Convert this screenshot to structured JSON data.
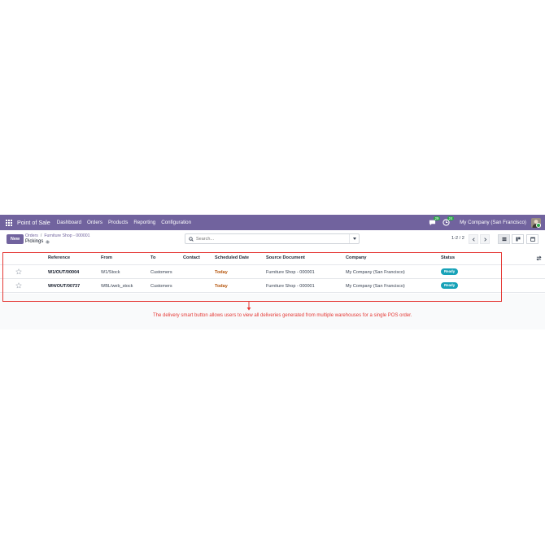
{
  "navbar": {
    "app_name": "Point of Sale",
    "menu": [
      "Dashboard",
      "Orders",
      "Products",
      "Reporting",
      "Configuration"
    ],
    "messages_count": "29",
    "activities_count": "24",
    "company": "My Company (San Francisco)"
  },
  "control": {
    "new_label": "New",
    "breadcrumb": [
      "Orders",
      "Furniture Shop - 000001"
    ],
    "breadcrumb_sep": "/",
    "title": "Pickings",
    "search_placeholder": "Search...",
    "pager": "1-2 / 2"
  },
  "table": {
    "columns": [
      "Reference",
      "From",
      "To",
      "Contact",
      "Scheduled Date",
      "Source Document",
      "Company",
      "Status"
    ],
    "rows": [
      {
        "reference": "W1/OUT/00004",
        "from": "W1/Stock",
        "to": "Customers",
        "contact": "",
        "scheduled_date": "Today",
        "source_document": "Furniture Shop - 000001",
        "company": "My Company (San Francisco)",
        "status": "Ready"
      },
      {
        "reference": "WH/OUT/00737",
        "from": "WBL/web_stock",
        "to": "Customers",
        "contact": "",
        "scheduled_date": "Today",
        "source_document": "Furniture Shop - 000001",
        "company": "My Company (San Francisco)",
        "status": "Ready"
      }
    ]
  },
  "annotation": {
    "text": "The delivery smart button allows users to view all deliveries generated from multiple warehouses for a single POS order."
  },
  "colors": {
    "brand": "#71639e",
    "status_ready": "#17a2b8",
    "annotation": "#e53935",
    "today": "#b45309"
  }
}
